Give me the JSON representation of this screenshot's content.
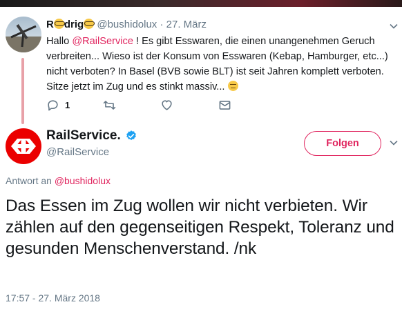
{
  "parent_tweet": {
    "name_start": "R",
    "name_end": "drig",
    "handle": "@bushidolux",
    "separator": "·",
    "date": "27. März",
    "text_greeting": "Hallo ",
    "mention": "@RailService",
    "text_body": " ! Es gibt Esswaren, die einen unangenehmen Geruch verbreiten... Wieso ist der Konsum von Esswaren (Kebap, Hamburger, etc...) nicht verboten? In Basel (BVB sowie BLT) ist seit Jahren komplett verboten. Sitze jetzt im Zug und es stinkt massiv...",
    "reply_count": "1",
    "icons": [
      "nerd-glasses-emoji",
      "unamused-face-emoji",
      "reply-icon",
      "retweet-icon",
      "heart-icon",
      "envelope-icon",
      "chevron-down-icon"
    ]
  },
  "main_tweet": {
    "name": "RailService.",
    "handle": "@RailService",
    "follow_label": "Folgen",
    "reply_to_label": "Antwort an ",
    "reply_to_handle": "@bushidolux",
    "text": "Das Essen im Zug wollen wir nicht verbieten. Wir zählen auf den gegenseitigen Respekt, Toleranz und gesunden Menschenverstand. /nk",
    "timestamp": "17:57 - 27. März 2018",
    "icons": [
      "sbb-logo-icon",
      "verified-badge-icon",
      "chevron-down-icon"
    ]
  },
  "colors": {
    "accent": "#e0245e",
    "text": "#14171a",
    "muted": "#657786",
    "thread_line": "#e8a1a8",
    "sbb_red": "#eb0000",
    "verified": "#1da1f2"
  }
}
